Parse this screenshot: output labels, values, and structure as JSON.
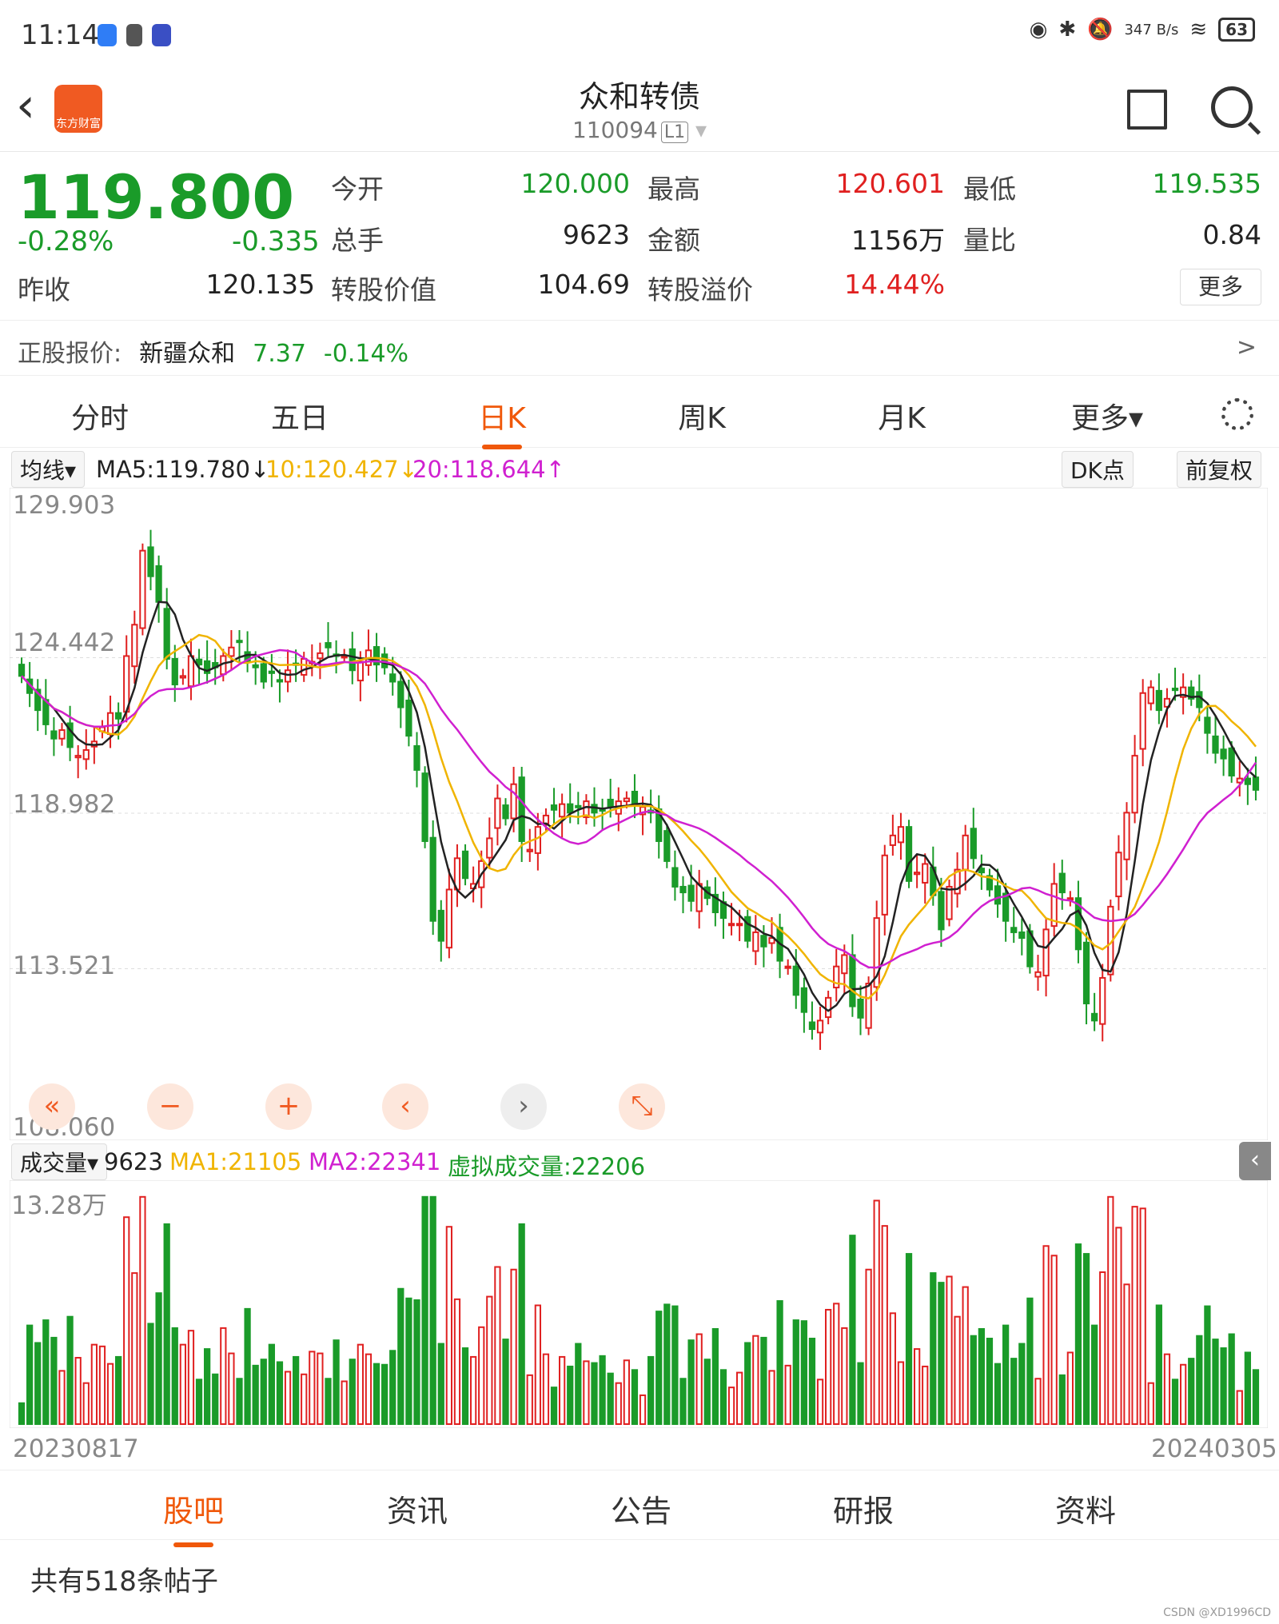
{
  "status": {
    "time": "11:14",
    "net_speed": "347 B/s",
    "battery": "63"
  },
  "header": {
    "back_icon": "chevron-left",
    "title": "众和转债",
    "code": "110094",
    "level": "L1"
  },
  "quote": {
    "price": "119.800",
    "pct": "-0.28%",
    "chg": "-0.335",
    "open_label": "今开",
    "open": "120.000",
    "high_label": "最高",
    "high": "120.601",
    "low_label": "最低",
    "low": "119.535",
    "hands_label": "总手",
    "hands": "9623",
    "amount_label": "金额",
    "amount": "1156万",
    "ratio_label": "量比",
    "ratio": "0.84",
    "prev_label": "昨收",
    "prev": "120.135",
    "conv_value_label": "转股价值",
    "conv_value": "104.69",
    "premium_label": "转股溢价",
    "premium": "14.44%",
    "more_label": "更多"
  },
  "stock": {
    "label": "正股报价:",
    "name": "新疆众和",
    "price": "7.37",
    "pct": "-0.14%",
    "arrow": ">"
  },
  "tabs": [
    "分时",
    "五日",
    "日K",
    "周K",
    "月K",
    "更多▾"
  ],
  "ma": {
    "selector": "均线▾",
    "ma5": "MA5:119.780↓",
    "ma10": "10:120.427↓",
    "ma20": "20:118.644↑",
    "dk": "DK点",
    "adjust": "前复权"
  },
  "vol": {
    "selector": "成交量▾",
    "value": "9623",
    "ma1": "MA1:21105",
    "ma2": "MA2:22341",
    "virtual": "虚拟成交量:22206",
    "ymax": "13.28万"
  },
  "axis": {
    "y": [
      "129.903",
      "124.442",
      "118.982",
      "113.521",
      "108.060"
    ],
    "date_start": "20230817",
    "date_end": "20240305"
  },
  "zoom_buttons": [
    "«",
    "−",
    "+",
    "‹",
    "›",
    "⤡"
  ],
  "bottom_tabs": [
    "股吧",
    "资讯",
    "公告",
    "研报",
    "资料"
  ],
  "posts": "共有518条帖子",
  "watermark": "CSDN @XD1996CD",
  "colors": {
    "up": "#e02020",
    "down": "#1a9b29",
    "accent": "#f0580a",
    "ma5": "#222222",
    "ma10": "#f0b400",
    "ma20": "#d020d0"
  },
  "chart_data": {
    "type": "candlestick",
    "ylim": [
      108.06,
      129.903
    ],
    "start_date": "20230817",
    "end_date": "20240305",
    "close": [
      123.8,
      123.2,
      122.6,
      122.1,
      121.6,
      121.9,
      121.3,
      121.0,
      121.2,
      121.5,
      122.0,
      122.5,
      122.3,
      124.5,
      125.6,
      128.2,
      127.3,
      126.4,
      124.4,
      123.5,
      123.8,
      124.5,
      124.2,
      123.9,
      124.1,
      124.5,
      124.8,
      125.0,
      124.3,
      124.1,
      123.6,
      123.9,
      123.6,
      124.0,
      124.2,
      124.4,
      124.3,
      124.6,
      124.8,
      124.5,
      124.5,
      124.0,
      124.3,
      124.7,
      124.2,
      124.1,
      123.6,
      122.7,
      121.7,
      120.5,
      118.0,
      115.2,
      114.5,
      116.3,
      117.4,
      116.7,
      116.5,
      117.3,
      118.1,
      119.5,
      118.8,
      120.0,
      118.0,
      117.7,
      118.5,
      118.9,
      119.1,
      119.3,
      119.0,
      119.2,
      119.4,
      119.0,
      119.1,
      119.2,
      119.4,
      119.5,
      119.3,
      119.2,
      119.0,
      118.0,
      117.3,
      116.4,
      116.2,
      115.9,
      116.5,
      116.0,
      115.5,
      115.3,
      115.1,
      115.1,
      114.5,
      114.8,
      114.3,
      114.6,
      113.8,
      113.6,
      112.6,
      112.0,
      111.4,
      111.7,
      112.5,
      113.6,
      114.0,
      112.2,
      111.8,
      113.0,
      115.3,
      117.5,
      118.2,
      118.5,
      116.6,
      116.9,
      117.2,
      116.1,
      114.9,
      116.4,
      117.0,
      118.2,
      117.4,
      116.9,
      116.3,
      115.8,
      115.2,
      114.8,
      114.6,
      113.6,
      113.4,
      114.9,
      116.5,
      116.2,
      116.0,
      114.2,
      112.3,
      111.7,
      113.2,
      115.7,
      117.6,
      119.0,
      121.0,
      123.2,
      123.4,
      122.6,
      123.0,
      123.3,
      123.4,
      123.0,
      122.7,
      121.8,
      121.1,
      120.9,
      120.3,
      120.2,
      120.0,
      119.8
    ]
  }
}
